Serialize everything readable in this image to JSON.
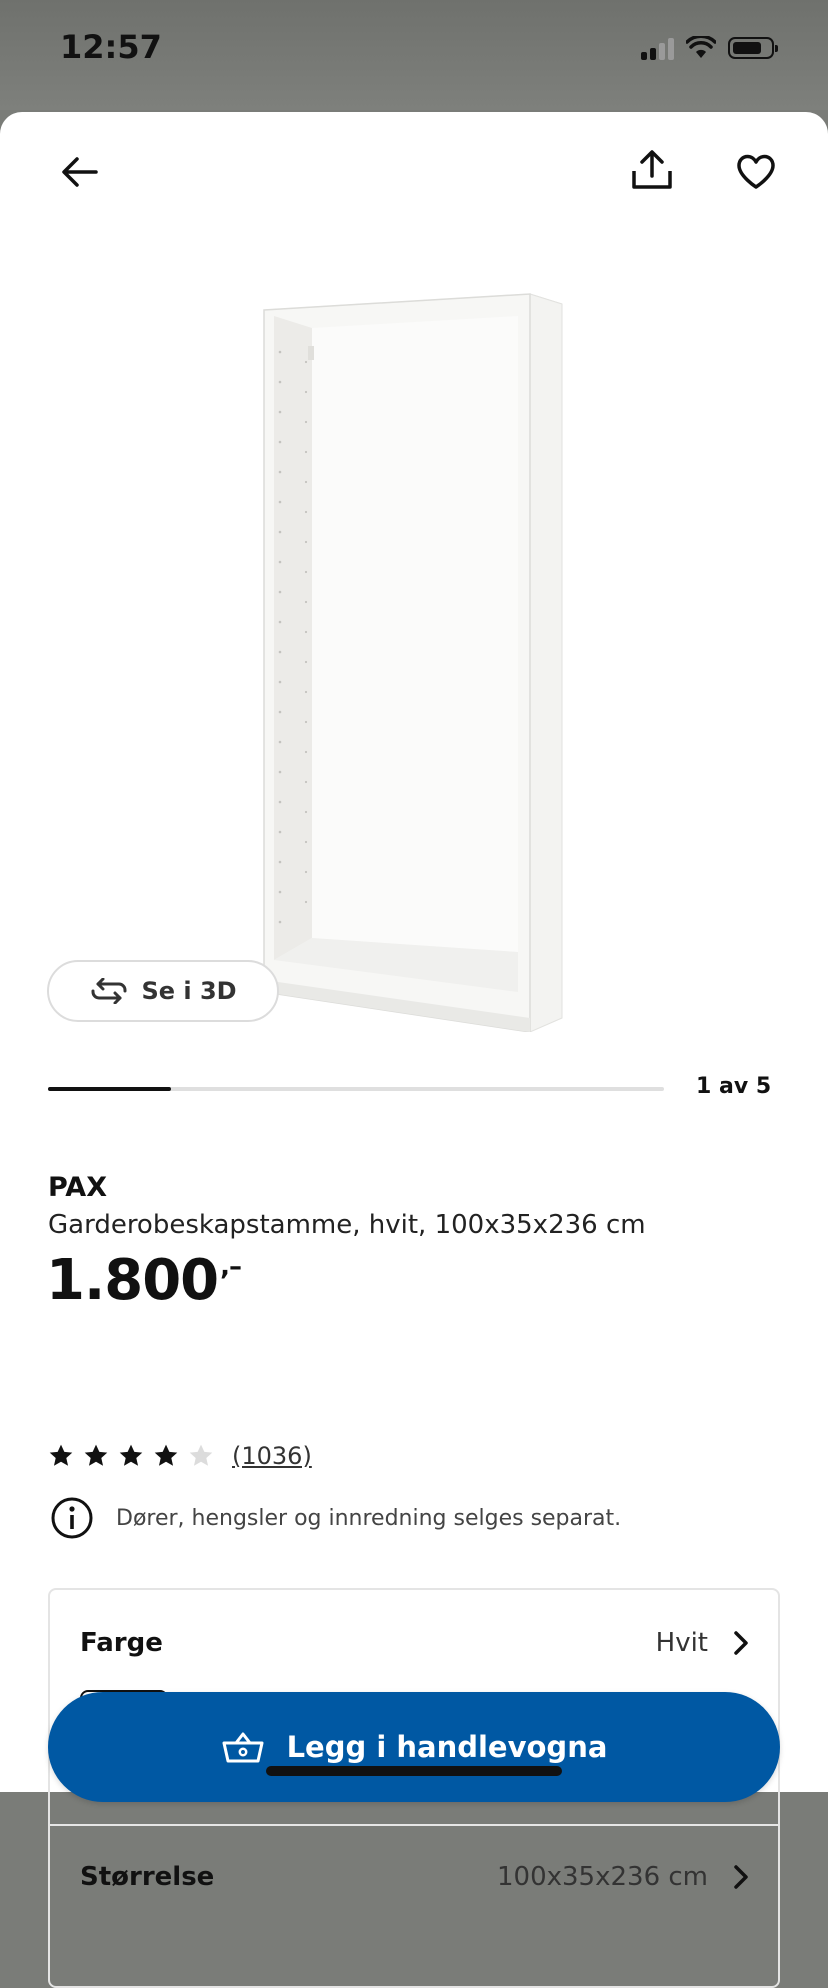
{
  "status_bar": {
    "time": "12:57"
  },
  "header": {
    "back_icon": "arrow-left-icon",
    "share_icon": "share-icon",
    "favorite_icon": "heart-icon"
  },
  "gallery": {
    "view_3d_label": "Se i 3D",
    "view_3d_icon": "rotate-3d-icon",
    "page_counter": "1 av 5",
    "current_page": 1,
    "total_pages": 5
  },
  "product": {
    "name": "PAX",
    "description": "Garderobeskapstamme, hvit, 100x35x236 cm",
    "price": "1.800",
    "price_suffix": ",–",
    "rating": 4,
    "rating_max": 5,
    "review_count": "(1036)",
    "info_text": "Dører, hengsler og innredning selges separat."
  },
  "options": {
    "color_label": "Farge",
    "color_value": "Hvit",
    "size_label": "Størrelse",
    "size_value": "100x35x236 cm"
  },
  "cart": {
    "label": "Legg i handlevogna",
    "icon": "basket-icon"
  },
  "colors": {
    "accent": "#0058a3",
    "star_filled": "#111111",
    "star_empty": "#dcdcdc"
  }
}
